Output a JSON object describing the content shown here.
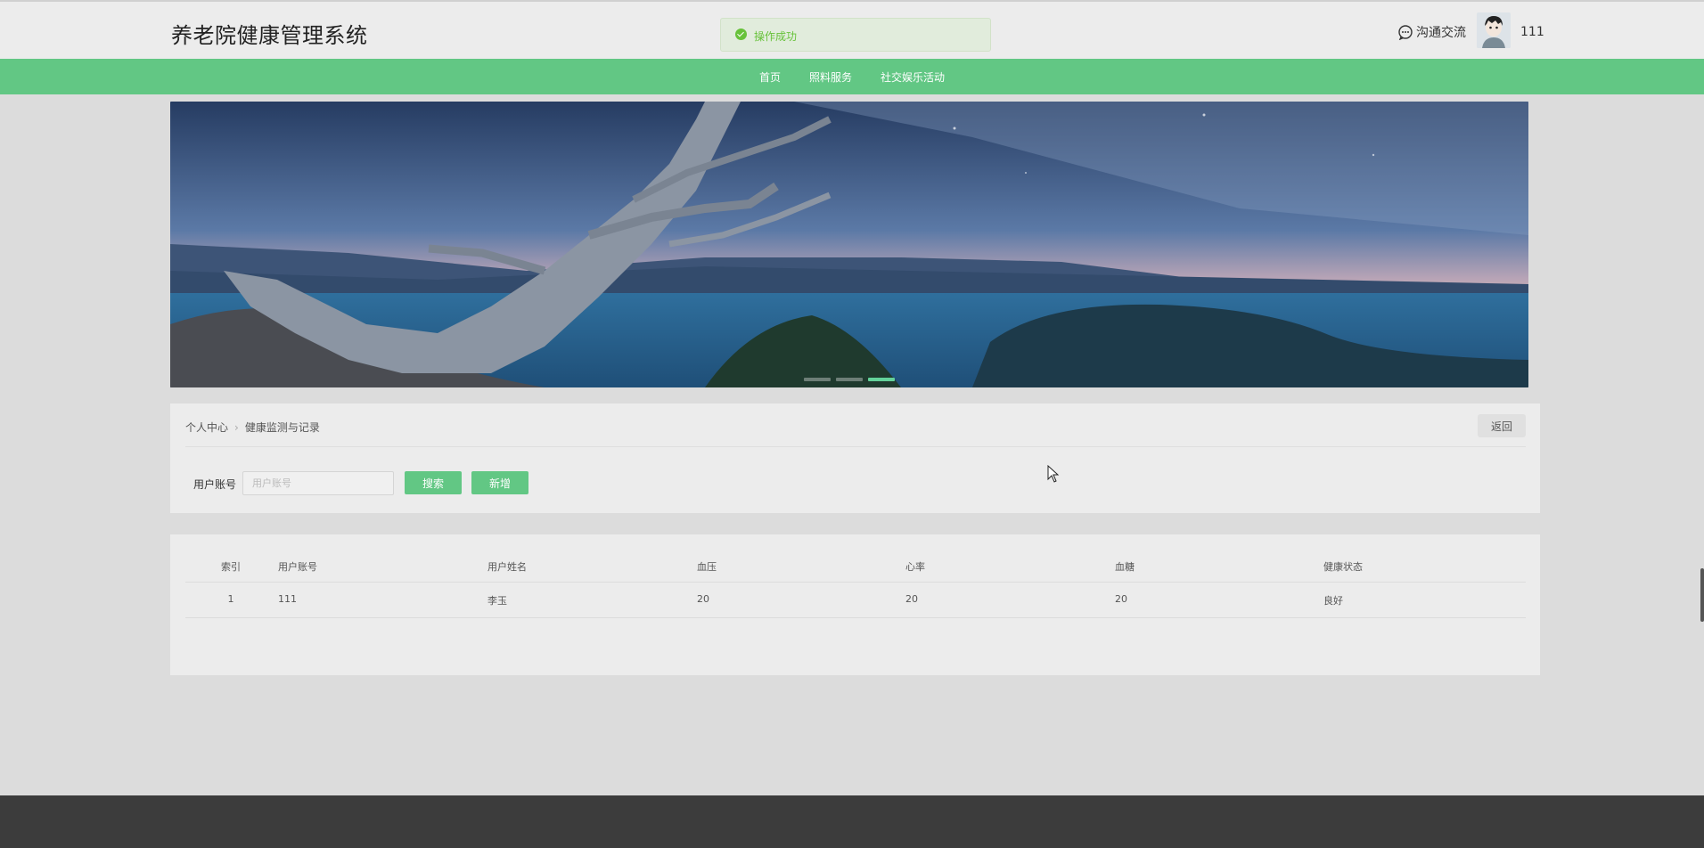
{
  "header": {
    "site_title": "养老院健康管理系统",
    "toast_message": "操作成功",
    "chat_label": "沟通交流",
    "username": "111"
  },
  "nav": {
    "items": [
      {
        "label": "首页"
      },
      {
        "label": "照料服务"
      },
      {
        "label": "社交娱乐活动"
      }
    ]
  },
  "banner": {
    "slide_count": 3,
    "active_index": 2
  },
  "breadcrumb": {
    "items": [
      "个人中心",
      "健康监测与记录"
    ]
  },
  "actions": {
    "back_label": "返回"
  },
  "search": {
    "label": "用户账号",
    "placeholder": "用户账号",
    "value": "",
    "search_button": "搜索",
    "add_button": "新增"
  },
  "table": {
    "columns": [
      "索引",
      "用户账号",
      "用户姓名",
      "血压",
      "心率",
      "血糖",
      "健康状态"
    ],
    "rows": [
      [
        "1",
        "111",
        "李玉",
        "20",
        "20",
        "20",
        "良好"
      ]
    ]
  },
  "colors": {
    "accent": "#62c784",
    "success": "#67c23a",
    "footer": "#3c3c3c"
  }
}
